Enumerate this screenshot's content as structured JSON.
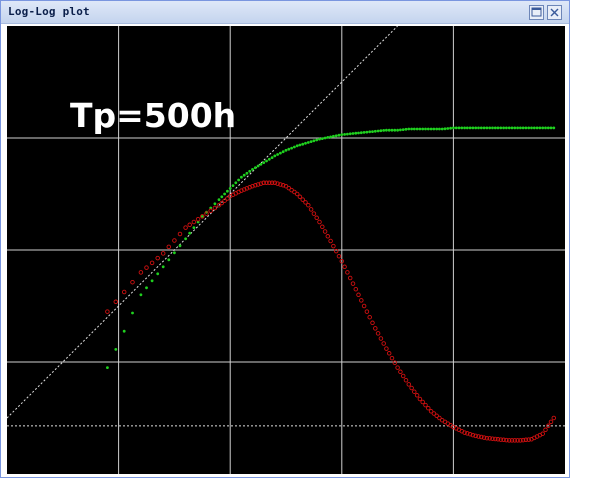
{
  "window": {
    "title": "Log-Log plot",
    "maximize_icon": "maximize-icon",
    "close_icon": "close-icon"
  },
  "chart_data": {
    "type": "scatter",
    "title": "Tp=500h",
    "xlabel": "",
    "ylabel": "",
    "scale": "log-log",
    "grid": true,
    "grid_color": "#d0d0d0",
    "background": "#000000",
    "xlim": [
      0,
      5
    ],
    "ylim": [
      0,
      4
    ],
    "series": [
      {
        "color": "#1fd01f",
        "points": [
          [
            0.9,
            0.95
          ],
          [
            1.2,
            1.6
          ],
          [
            1.4,
            1.85
          ],
          [
            1.6,
            2.1
          ],
          [
            1.75,
            2.3
          ],
          [
            1.9,
            2.45
          ],
          [
            2.0,
            2.55
          ],
          [
            2.1,
            2.65
          ],
          [
            2.2,
            2.72
          ],
          [
            2.3,
            2.78
          ],
          [
            2.4,
            2.84
          ],
          [
            2.5,
            2.89
          ],
          [
            2.6,
            2.93
          ],
          [
            2.7,
            2.96
          ],
          [
            2.8,
            2.99
          ],
          [
            2.9,
            3.01
          ],
          [
            3.0,
            3.03
          ],
          [
            3.1,
            3.04
          ],
          [
            3.2,
            3.05
          ],
          [
            3.3,
            3.06
          ],
          [
            3.4,
            3.07
          ],
          [
            3.5,
            3.07
          ],
          [
            3.6,
            3.08
          ],
          [
            3.7,
            3.08
          ],
          [
            3.8,
            3.08
          ],
          [
            3.9,
            3.08
          ],
          [
            4.0,
            3.09
          ],
          [
            4.1,
            3.09
          ],
          [
            4.2,
            3.09
          ],
          [
            4.3,
            3.09
          ],
          [
            4.4,
            3.09
          ],
          [
            4.5,
            3.09
          ],
          [
            4.6,
            3.09
          ],
          [
            4.7,
            3.09
          ],
          [
            4.8,
            3.09
          ],
          [
            4.9,
            3.09
          ]
        ]
      },
      {
        "color": "#d01010",
        "points": [
          [
            0.9,
            1.45
          ],
          [
            1.2,
            1.8
          ],
          [
            1.4,
            1.97
          ],
          [
            1.6,
            2.2
          ],
          [
            1.75,
            2.3
          ],
          [
            1.9,
            2.4
          ],
          [
            2.0,
            2.48
          ],
          [
            2.1,
            2.53
          ],
          [
            2.2,
            2.57
          ],
          [
            2.3,
            2.6
          ],
          [
            2.4,
            2.6
          ],
          [
            2.5,
            2.57
          ],
          [
            2.6,
            2.5
          ],
          [
            2.7,
            2.4
          ],
          [
            2.8,
            2.25
          ],
          [
            2.9,
            2.08
          ],
          [
            3.0,
            1.9
          ],
          [
            3.1,
            1.7
          ],
          [
            3.2,
            1.5
          ],
          [
            3.3,
            1.3
          ],
          [
            3.4,
            1.12
          ],
          [
            3.5,
            0.95
          ],
          [
            3.6,
            0.8
          ],
          [
            3.7,
            0.67
          ],
          [
            3.8,
            0.56
          ],
          [
            3.9,
            0.48
          ],
          [
            4.0,
            0.42
          ],
          [
            4.1,
            0.37
          ],
          [
            4.2,
            0.34
          ],
          [
            4.3,
            0.32
          ],
          [
            4.4,
            0.31
          ],
          [
            4.5,
            0.3
          ],
          [
            4.6,
            0.3
          ],
          [
            4.7,
            0.31
          ],
          [
            4.8,
            0.36
          ],
          [
            4.9,
            0.5
          ]
        ]
      }
    ],
    "reference_lines": [
      {
        "kind": "diagonal",
        "from": [
          0,
          0.5
        ],
        "to": [
          3.5,
          4.0
        ]
      },
      {
        "kind": "horizontal",
        "y": 0.43
      }
    ]
  }
}
